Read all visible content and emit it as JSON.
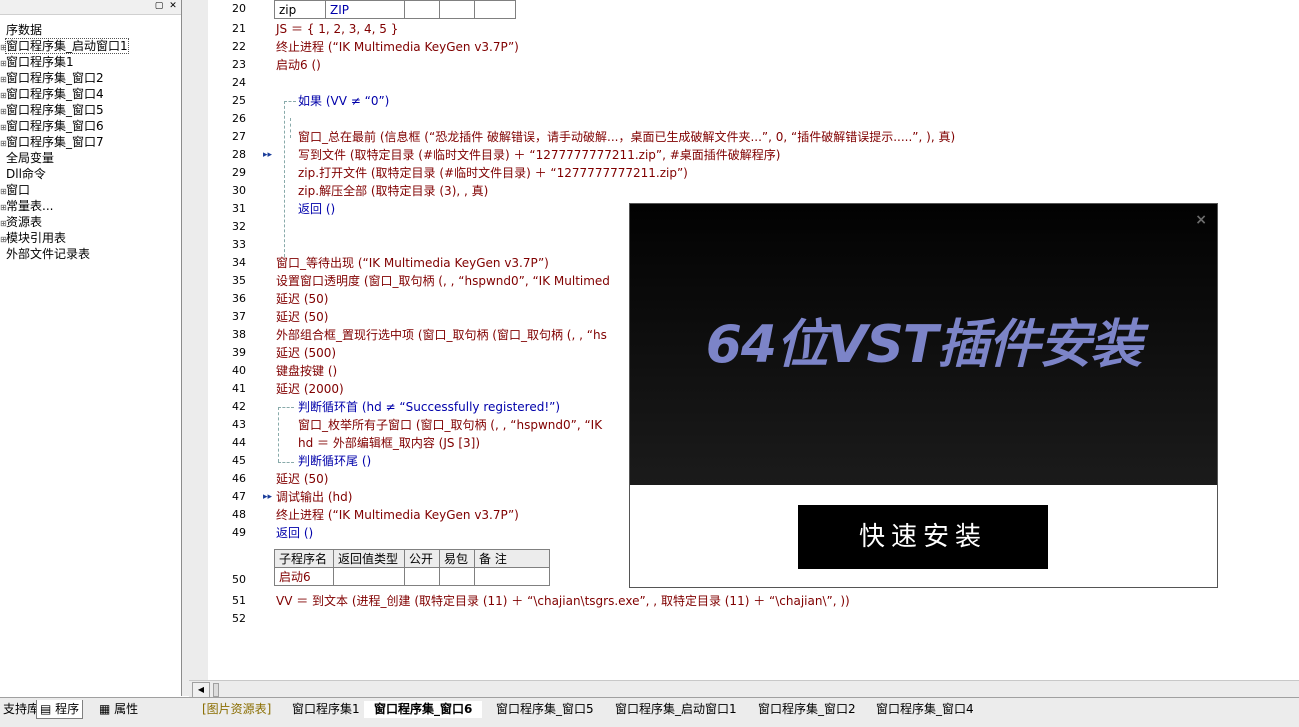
{
  "sidebar": {
    "items": [
      {
        "label": "序数据",
        "toggle": ""
      },
      {
        "label": "窗口程序集_启动窗口1",
        "toggle": "⊞"
      },
      {
        "label": "窗口程序集1",
        "toggle": "⊞"
      },
      {
        "label": "窗口程序集_窗口2",
        "toggle": "⊞"
      },
      {
        "label": "窗口程序集_窗口4",
        "toggle": "⊞"
      },
      {
        "label": "窗口程序集_窗口5",
        "toggle": "⊞"
      },
      {
        "label": "窗口程序集_窗口6",
        "toggle": "⊞"
      },
      {
        "label": "窗口程序集_窗口7",
        "toggle": "⊞"
      },
      {
        "label": "全局变量",
        "toggle": ""
      },
      {
        "label": "Dll命令",
        "toggle": ""
      },
      {
        "label": "窗口",
        "toggle": "⊞"
      },
      {
        "label": "常量表...",
        "toggle": "⊞"
      },
      {
        "label": "资源表",
        "toggle": "⊞"
      },
      {
        "label": "模块引用表",
        "toggle": "⊞"
      },
      {
        "label": "外部文件记录表",
        "toggle": ""
      }
    ]
  },
  "top_table": {
    "cells": [
      "zip",
      "ZIP",
      "",
      "",
      ""
    ]
  },
  "lines": [
    {
      "n": "20"
    },
    {
      "n": "21",
      "text": "JS ＝ { 1, 2, 3, 4, 5 }"
    },
    {
      "n": "22",
      "text": "终止进程 (“IK Multimedia KeyGen v3.7P”)"
    },
    {
      "n": "23",
      "text": "启动6 ()"
    },
    {
      "n": "24",
      "text": ""
    },
    {
      "n": "25",
      "text": "如果 (VV ≠ “0”)"
    },
    {
      "n": "26",
      "text": ""
    },
    {
      "n": "27",
      "text": "窗口_总在最前 (信息框 (“恐龙插件  破解错误，请手动破解...，桌面已生成破解文件夹...”, 0, “插件破解错误提示.....”, ), 真)"
    },
    {
      "n": "28",
      "text": "写到文件 (取特定目录 (#临时文件目录) ＋ “1277777777211.zip”, #桌面插件破解程序)"
    },
    {
      "n": "29",
      "text": "zip.打开文件 (取特定目录 (#临时文件目录) ＋ “1277777777211.zip”)"
    },
    {
      "n": "30",
      "text": "zip.解压全部 (取特定目录 (3), , 真)"
    },
    {
      "n": "31",
      "text": "返回 ()"
    },
    {
      "n": "32",
      "text": ""
    },
    {
      "n": "33",
      "text": ""
    },
    {
      "n": "34",
      "text": "窗口_等待出现 (“IK Multimedia KeyGen v3.7P”)"
    },
    {
      "n": "35",
      "text": "设置窗口透明度 (窗口_取句柄 (, , “hspwnd0”, “IK Multimed"
    },
    {
      "n": "36",
      "text": "延迟 (50)"
    },
    {
      "n": "37",
      "text": "延迟 (50)"
    },
    {
      "n": "38",
      "text": "外部组合框_置现行选中项 (窗口_取句柄 (窗口_取句柄 (, , “hs"
    },
    {
      "n": "39",
      "text": "延迟 (500)"
    },
    {
      "n": "40",
      "text": "键盘按键 ()"
    },
    {
      "n": "41",
      "text": "延迟 (2000)"
    },
    {
      "n": "42",
      "text": "判断循环首 (hd ≠ “Successfully registered!”)"
    },
    {
      "n": "43",
      "text": "窗口_枚举所有子窗口 (窗口_取句柄 (, , “hspwnd0”, “IK"
    },
    {
      "n": "44",
      "text": "hd ＝ 外部编辑框_取内容 (JS [3])"
    },
    {
      "n": "45",
      "text": "判断循环尾 ()"
    },
    {
      "n": "46",
      "text": "延迟 (50)"
    },
    {
      "n": "47",
      "text": "调试输出 (hd)"
    },
    {
      "n": "48",
      "text": "终止进程 (“IK Multimedia KeyGen v3.7P”)"
    },
    {
      "n": "49",
      "text": "返回 ()"
    },
    {
      "n": "50"
    },
    {
      "n": "51",
      "text": "VV ＝ 到文本 (进程_创建 (取特定目录 (11) ＋ “\\chajian\\tsgrs.exe”, , 取特定目录 (11) ＋ “\\chajian\\”, ))"
    },
    {
      "n": "52",
      "text": ""
    }
  ],
  "sub_table": {
    "headers": [
      "子程序名",
      "返回值类型",
      "公开",
      "易包",
      "备 注"
    ],
    "row": [
      "启动6",
      "",
      "",
      "",
      ""
    ]
  },
  "left_tabs": [
    "支持库",
    "程序",
    "属性"
  ],
  "editor_tabs": [
    "[图片资源表]",
    "窗口程序集1",
    "窗口程序集_窗口6",
    "窗口程序集_窗口5",
    "窗口程序集_启动窗口1",
    "窗口程序集_窗口2",
    "窗口程序集_窗口4"
  ],
  "overlay": {
    "title": "64位VST插件安装",
    "button": "快速安装",
    "close": "×"
  },
  "window_buttons": {
    "min": "▢",
    "close": "✕"
  }
}
